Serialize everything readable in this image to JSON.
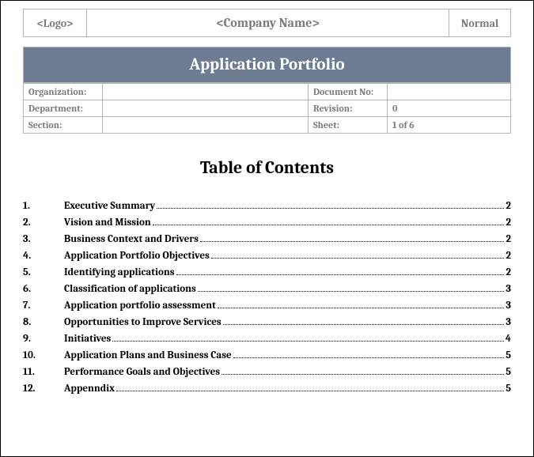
{
  "header": {
    "logo_placeholder": "<Logo>",
    "company_placeholder": "<Company Name>",
    "mode": "Normal"
  },
  "title_bar": "Application Portfolio",
  "meta": {
    "organization_label": "Organization:",
    "organization_value": "",
    "department_label": "Department:",
    "department_value": "",
    "section_label": "Section:",
    "section_value": "",
    "docno_label": "Document No:",
    "docno_value": "",
    "revision_label": "Revision:",
    "revision_value": "0",
    "sheet_label": "Sheet:",
    "sheet_value": "1 of 6"
  },
  "toc_heading": "Table of Contents",
  "toc": [
    {
      "num": "1.",
      "title": "Executive Summary",
      "page": "2"
    },
    {
      "num": "2.",
      "title": "Vision and Mission",
      "page": "2"
    },
    {
      "num": "3.",
      "title": "Business Context and Drivers",
      "page": "2"
    },
    {
      "num": "4.",
      "title": "Application Portfolio Objectives",
      "page": "2"
    },
    {
      "num": "5.",
      "title": "Identifying applications",
      "page": "2"
    },
    {
      "num": "6.",
      "title": "Classification of applications",
      "page": "3"
    },
    {
      "num": "7.",
      "title": "Application portfolio assessment",
      "page": "3"
    },
    {
      "num": "8.",
      "title": "Opportunities to Improve Services",
      "page": "3"
    },
    {
      "num": "9.",
      "title": "Initiatives",
      "page": "4"
    },
    {
      "num": "10.",
      "title": "Application Plans and Business Case",
      "page": "5"
    },
    {
      "num": "11.",
      "title": "Performance Goals and Objectives",
      "page": "5"
    },
    {
      "num": "12.",
      "title": "Appenndix",
      "page": "5"
    }
  ]
}
